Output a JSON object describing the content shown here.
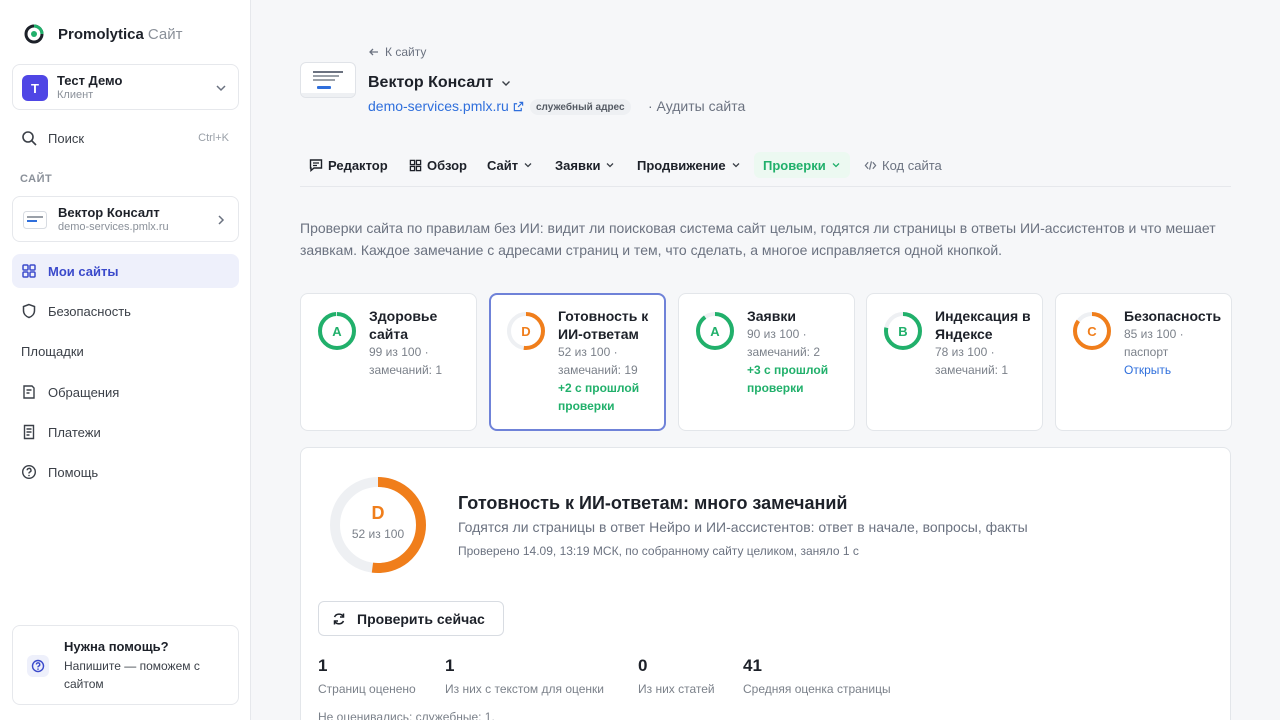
{
  "brand": {
    "name": "Promolytica",
    "suffix": "Сайт"
  },
  "account": {
    "initial": "Т",
    "name": "Тест Демо",
    "role": "Клиент"
  },
  "search": {
    "label": "Поиск",
    "shortcut": "Ctrl+K"
  },
  "sidebar": {
    "section_label": "САЙТ",
    "site": {
      "name": "Вектор Консалт",
      "url": "demo-services.pmlx.ru"
    },
    "items": [
      {
        "label": "Мои сайты"
      },
      {
        "label": "Безопасность"
      },
      {
        "label": "Площадки"
      },
      {
        "label": "Обращения"
      },
      {
        "label": "Платежи"
      },
      {
        "label": "Помощь"
      }
    ],
    "help": {
      "title": "Нужна помощь?",
      "text": "Напишите — поможем с сайтом"
    }
  },
  "header": {
    "back": "К сайту",
    "site_name": "Вектор Консалт",
    "site_url": "demo-services.pmlx.ru",
    "badge": "служебный адрес",
    "breadcrumb": "· Аудиты сайта"
  },
  "tabs": [
    {
      "label": "Редактор"
    },
    {
      "label": "Обзор"
    },
    {
      "label": "Сайт"
    },
    {
      "label": "Заявки"
    },
    {
      "label": "Продвижение"
    },
    {
      "label": "Проверки"
    },
    {
      "label": "Код сайта"
    }
  ],
  "intro": "Проверки сайта по правилам без ИИ: видит ли поисковая система сайт целым, годятся ли страницы в ответы ИИ-ассистентов и что мешает заявкам. Каждое замечание с адресами страниц и тем, что сделать, а многое исправляется одной кнопкой.",
  "metrics": [
    {
      "grade": "A",
      "title": "Здоровье сайта",
      "meta": "99 из 100 · замечаний: 1",
      "score": 99,
      "color": "#21b06b"
    },
    {
      "grade": "D",
      "title": "Готовность к ИИ-ответам",
      "meta": "52 из 100 · замечаний: 19",
      "delta": "+2 с прошлой проверки",
      "score": 52,
      "color": "#f07e1b"
    },
    {
      "grade": "A",
      "title": "Заявки",
      "meta": "90 из 100 · замечаний: 2",
      "delta": "+3 с прошлой проверки",
      "score": 90,
      "color": "#21b06b"
    },
    {
      "grade": "B",
      "title": "Индексация в Яндексе",
      "meta": "78 из 100 · замечаний: 1",
      "score": 78,
      "color": "#21b06b"
    },
    {
      "grade": "C",
      "title": "Безопасность",
      "meta": "85 из 100 · паспорт",
      "link": "Открыть",
      "score": 85,
      "color": "#f07e1b"
    }
  ],
  "detail": {
    "grade": "D",
    "score": "52 из 100",
    "score_value": 52,
    "title": "Готовность к ИИ-ответам: много замечаний",
    "subtitle": "Годятся ли страницы в ответ Нейро и ИИ-ассистентов: ответ в начале, вопросы, факты",
    "meta": "Проверено 14.09, 13:19 МСК, по собранному сайту целиком, заняло 1 с",
    "button": "Проверить сейчас",
    "stats": [
      {
        "value": "1",
        "label": "Страниц оценено"
      },
      {
        "value": "1",
        "label": "Из них с текстом для оценки"
      },
      {
        "value": "0",
        "label": "Из них статей"
      },
      {
        "value": "41",
        "label": "Средняя оценка страницы"
      }
    ],
    "footnote": "Не оценивались: служебные: 1."
  },
  "colors": {
    "accent": "#3b4acb",
    "green": "#21b06b",
    "orange": "#f07e1b",
    "link": "#2f6fdc"
  }
}
